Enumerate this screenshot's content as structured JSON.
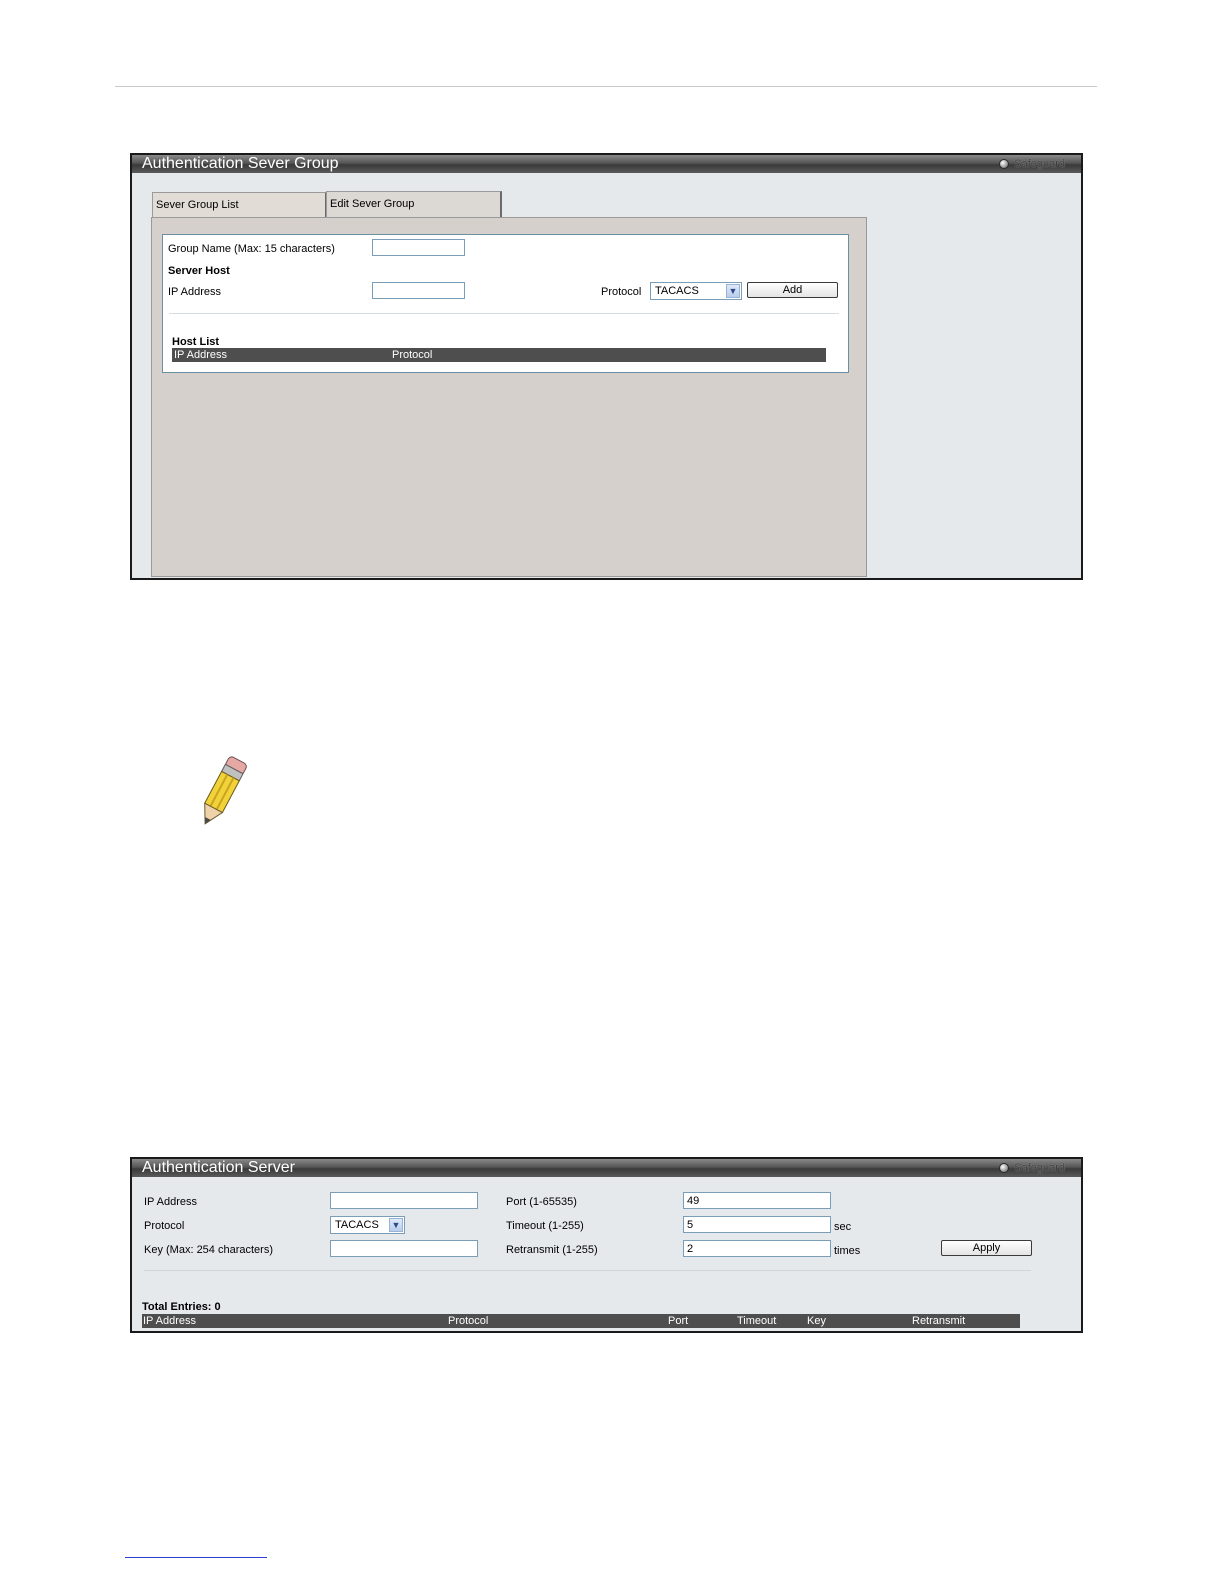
{
  "server_group_panel": {
    "title": "Authentication Sever Group",
    "safeguard": "Safeguard",
    "tabs": [
      {
        "label": "Sever Group List"
      },
      {
        "label": "Edit Sever Group"
      }
    ],
    "group_name_label": "Group Name  (Max: 15 characters)",
    "group_name_value": "",
    "server_host_label": "Server Host",
    "ip_address_label": "IP Address",
    "ip_address_value": "",
    "protocol_label": "Protocol",
    "protocol_value": "TACACS",
    "add_button": "Add",
    "host_list_label": "Host List",
    "host_list_columns": [
      "IP Address",
      "Protocol"
    ]
  },
  "note_icon": "pencil-note-icon",
  "server_panel": {
    "title": "Authentication Server",
    "safeguard": "Safeguard",
    "ip_address_label": "IP Address",
    "ip_address_value": "",
    "protocol_label": "Protocol",
    "protocol_value": "TACACS",
    "key_label": "Key (Max: 254 characters)",
    "key_value": "",
    "port_label": "Port (1-65535)",
    "port_value": "49",
    "timeout_label": "Timeout (1-255)",
    "timeout_value": "5",
    "timeout_unit": "sec",
    "retransmit_label": "Retransmit (1-255)",
    "retransmit_value": "2",
    "retransmit_unit": "times",
    "apply_button": "Apply",
    "total_entries": "Total Entries: 0",
    "columns": [
      "IP Address",
      "Protocol",
      "Port",
      "Timeout",
      "Key",
      "Retransmit"
    ]
  },
  "colors": {
    "title_bar": "#4a4a4a",
    "panel_bg": "#e6e9ec",
    "tab_body_bg": "#d6d0cc",
    "table_header_bg": "#4e4e4e",
    "input_border": "#7b9eb8"
  }
}
